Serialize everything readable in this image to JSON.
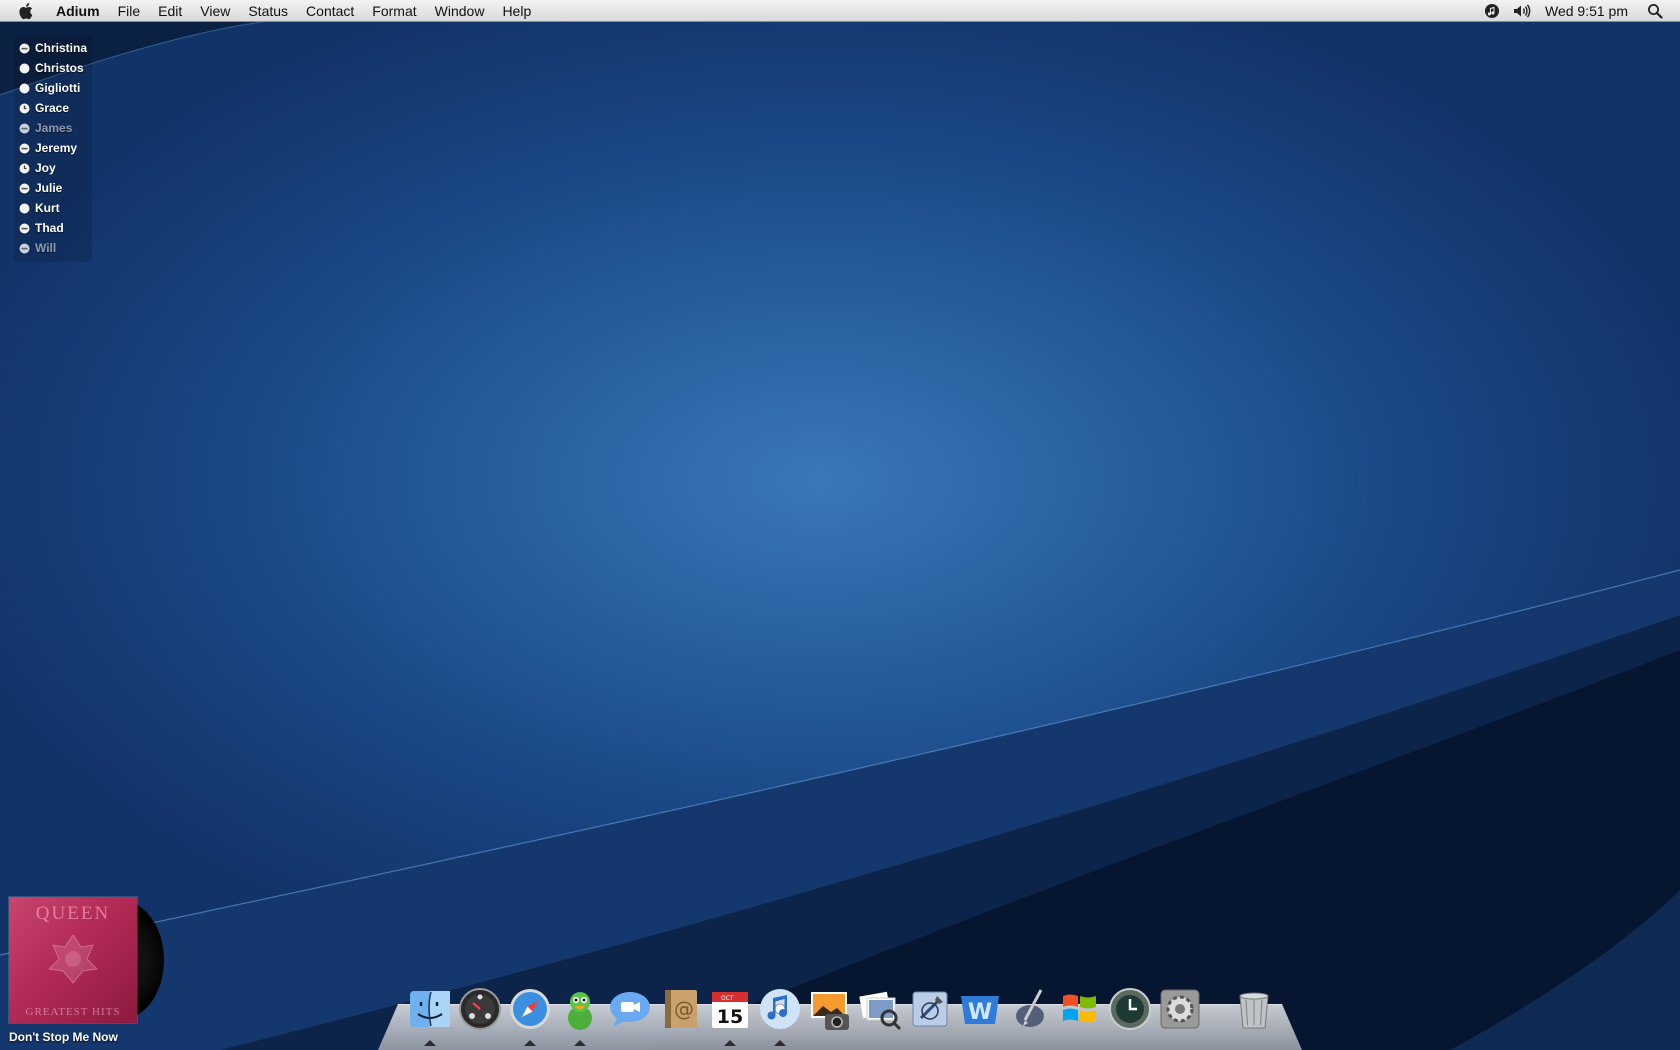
{
  "menubar": {
    "app_name": "Adium",
    "items": [
      "File",
      "Edit",
      "View",
      "Status",
      "Contact",
      "Format",
      "Window",
      "Help"
    ],
    "clock": "Wed 9:51 pm",
    "icons": [
      "apple-icon",
      "itunes-status-icon",
      "volume-icon",
      "spotlight-search-icon"
    ]
  },
  "contacts": [
    {
      "name": "Christina",
      "status": "away"
    },
    {
      "name": "Christos",
      "status": "available"
    },
    {
      "name": "Gigliotti",
      "status": "available"
    },
    {
      "name": "Grace",
      "status": "idle-clock"
    },
    {
      "name": "James",
      "status": "offline"
    },
    {
      "name": "Jeremy",
      "status": "away"
    },
    {
      "name": "Joy",
      "status": "idle-clock"
    },
    {
      "name": "Julie",
      "status": "away"
    },
    {
      "name": "Kurt",
      "status": "available"
    },
    {
      "name": "Thad",
      "status": "away"
    },
    {
      "name": "Will",
      "status": "offline"
    }
  ],
  "now_playing": {
    "album_text": "QUEEN",
    "album_subtitle": "GREATEST HITS",
    "track": "Don't Stop Me Now"
  },
  "dock": {
    "apps": [
      {
        "name": "finder",
        "running": true
      },
      {
        "name": "dashboard",
        "running": false
      },
      {
        "name": "safari",
        "running": true
      },
      {
        "name": "adium",
        "running": true
      },
      {
        "name": "ichat",
        "running": false
      },
      {
        "name": "address-book",
        "running": false
      },
      {
        "name": "ical",
        "running": true,
        "label": "15",
        "month": "OCT"
      },
      {
        "name": "itunes",
        "running": true
      },
      {
        "name": "iphoto",
        "running": false
      },
      {
        "name": "preview",
        "running": false
      },
      {
        "name": "xcode",
        "running": false
      },
      {
        "name": "word",
        "running": false
      },
      {
        "name": "script-editor",
        "running": false
      },
      {
        "name": "windows",
        "running": false
      },
      {
        "name": "time-machine",
        "running": false
      },
      {
        "name": "system-preferences",
        "running": false
      },
      {
        "name": "trash",
        "running": false
      }
    ]
  },
  "colors": {
    "wallpaper_center": "#3a78b8",
    "wallpaper_edge": "#123368",
    "contact_text": "#ffffff",
    "contact_idle_text": "#8e9bb0"
  }
}
